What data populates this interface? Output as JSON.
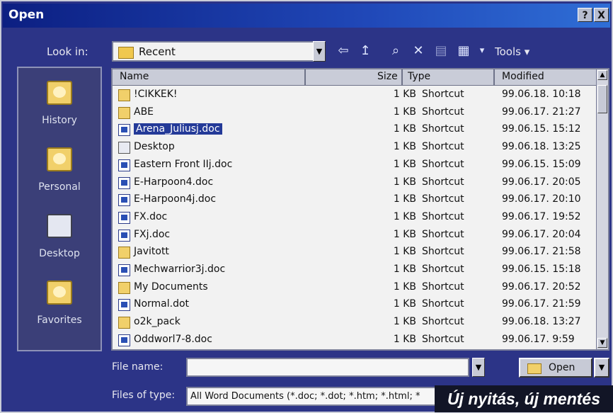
{
  "window": {
    "title": "Open",
    "help_btn": "?",
    "close_btn": "X"
  },
  "look_in": {
    "label": "Look in:",
    "value": "Recent"
  },
  "toolbar": {
    "back_icon": "⇦",
    "up_icon": "↥",
    "search_icon": "⌕",
    "delete_icon": "✕",
    "new_folder_icon": "▤",
    "views_icon": "▦",
    "views_dropdown": "▾",
    "tools_label": "Tools ▾"
  },
  "places": [
    {
      "label": "History"
    },
    {
      "label": "Personal"
    },
    {
      "label": "Desktop"
    },
    {
      "label": "Favorites"
    }
  ],
  "columns": {
    "name": "Name",
    "size": "Size",
    "type": "Type",
    "modified": "Modified"
  },
  "files": [
    {
      "icon": "folder",
      "name": "!CIKKEK!",
      "size": "1 KB",
      "type": "Shortcut",
      "modified": "99.06.18. 10:18"
    },
    {
      "icon": "folder",
      "name": "ABE",
      "size": "1 KB",
      "type": "Shortcut",
      "modified": "99.06.17. 21:27"
    },
    {
      "icon": "doc",
      "name": "Arena_Juliusj.doc",
      "size": "1 KB",
      "type": "Shortcut",
      "modified": "99.06.15. 15:12",
      "selected": true
    },
    {
      "icon": "desktop",
      "name": "Desktop",
      "size": "1 KB",
      "type": "Shortcut",
      "modified": "99.06.18. 13:25"
    },
    {
      "icon": "doc",
      "name": "Eastern Front IIj.doc",
      "size": "1 KB",
      "type": "Shortcut",
      "modified": "99.06.15. 15:09"
    },
    {
      "icon": "doc",
      "name": "E-Harpoon4.doc",
      "size": "1 KB",
      "type": "Shortcut",
      "modified": "99.06.17. 20:05"
    },
    {
      "icon": "doc",
      "name": "E-Harpoon4j.doc",
      "size": "1 KB",
      "type": "Shortcut",
      "modified": "99.06.17. 20:10"
    },
    {
      "icon": "doc",
      "name": "FX.doc",
      "size": "1 KB",
      "type": "Shortcut",
      "modified": "99.06.17. 19:52"
    },
    {
      "icon": "doc",
      "name": "FXj.doc",
      "size": "1 KB",
      "type": "Shortcut",
      "modified": "99.06.17. 20:04"
    },
    {
      "icon": "folder",
      "name": "Javitott",
      "size": "1 KB",
      "type": "Shortcut",
      "modified": "99.06.17. 21:58"
    },
    {
      "icon": "doc",
      "name": "Mechwarrior3j.doc",
      "size": "1 KB",
      "type": "Shortcut",
      "modified": "99.06.15. 15:18"
    },
    {
      "icon": "folder",
      "name": "My Documents",
      "size": "1 KB",
      "type": "Shortcut",
      "modified": "99.06.17. 20:52"
    },
    {
      "icon": "doc",
      "name": "Normal.dot",
      "size": "1 KB",
      "type": "Shortcut",
      "modified": "99.06.17. 21:59"
    },
    {
      "icon": "folder",
      "name": "o2k_pack",
      "size": "1 KB",
      "type": "Shortcut",
      "modified": "99.06.18. 13:27"
    },
    {
      "icon": "doc",
      "name": "Oddworl7-8.doc",
      "size": "1 KB",
      "type": "Shortcut",
      "modified": "99.06.17. 9:59"
    }
  ],
  "file_name": {
    "label": "File name:",
    "value": ""
  },
  "files_of_type": {
    "label": "Files of type:",
    "value": "All Word Documents (*.doc; *.dot; *.htm; *.html; *"
  },
  "open_button": {
    "label": "Open"
  },
  "overlay_caption": "Új nyitás, új mentés"
}
